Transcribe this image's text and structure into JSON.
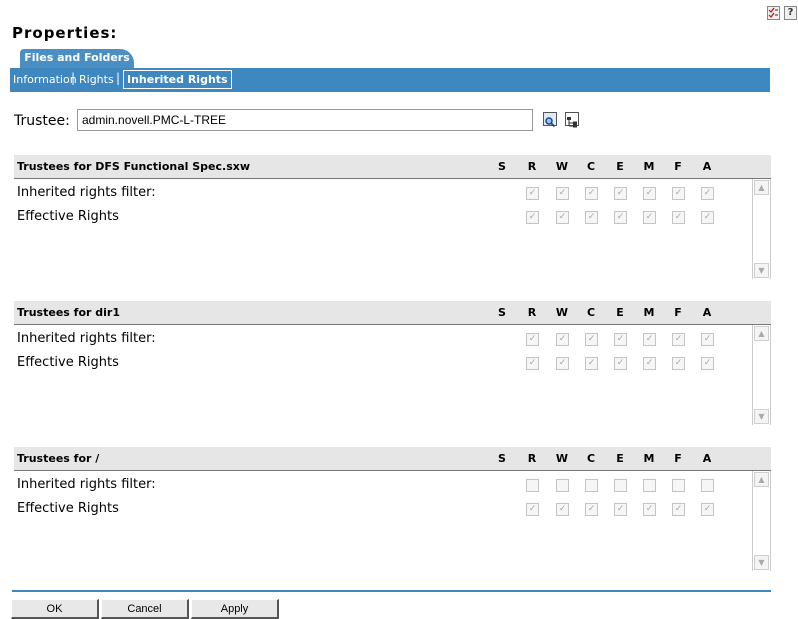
{
  "header": {
    "page_title": "Properties:",
    "icons": [
      "checklist-icon",
      "help-icon"
    ],
    "help_glyph": "?"
  },
  "tabs": {
    "active_tab": "Files and Folders"
  },
  "subnav": {
    "items": [
      "Information",
      "Rights",
      "Inherited Rights"
    ],
    "separator": "|",
    "active": "Inherited Rights"
  },
  "trustee": {
    "label": "Trustee:",
    "value": "admin.novell.PMC-L-TREE"
  },
  "rights_columns": [
    "S",
    "R",
    "W",
    "C",
    "E",
    "M",
    "F",
    "A"
  ],
  "sections": [
    {
      "title": "Trustees for DFS Functional Spec.sxw",
      "rows": [
        {
          "label": "Inherited rights filter:",
          "checked": [
            false,
            true,
            true,
            true,
            true,
            true,
            true,
            true
          ]
        },
        {
          "label": "Effective Rights",
          "checked": [
            false,
            true,
            true,
            true,
            true,
            true,
            true,
            true
          ]
        }
      ]
    },
    {
      "title": "Trustees for dir1",
      "rows": [
        {
          "label": "Inherited rights filter:",
          "checked": [
            false,
            true,
            true,
            true,
            true,
            true,
            true,
            true
          ]
        },
        {
          "label": "Effective Rights",
          "checked": [
            false,
            true,
            true,
            true,
            true,
            true,
            true,
            true
          ]
        }
      ]
    },
    {
      "title": "Trustees for /",
      "rows": [
        {
          "label": "Inherited rights filter:",
          "checked": [
            false,
            false,
            false,
            false,
            false,
            false,
            false,
            false
          ]
        },
        {
          "label": "Effective Rights",
          "checked": [
            false,
            true,
            true,
            true,
            true,
            true,
            true,
            true
          ]
        }
      ]
    }
  ],
  "buttons": {
    "ok": "OK",
    "cancel": "Cancel",
    "apply": "Apply"
  },
  "colors": {
    "accent": "#3f87bf",
    "tab": "#4a8fc4",
    "header_bg": "#e6e6e6"
  }
}
